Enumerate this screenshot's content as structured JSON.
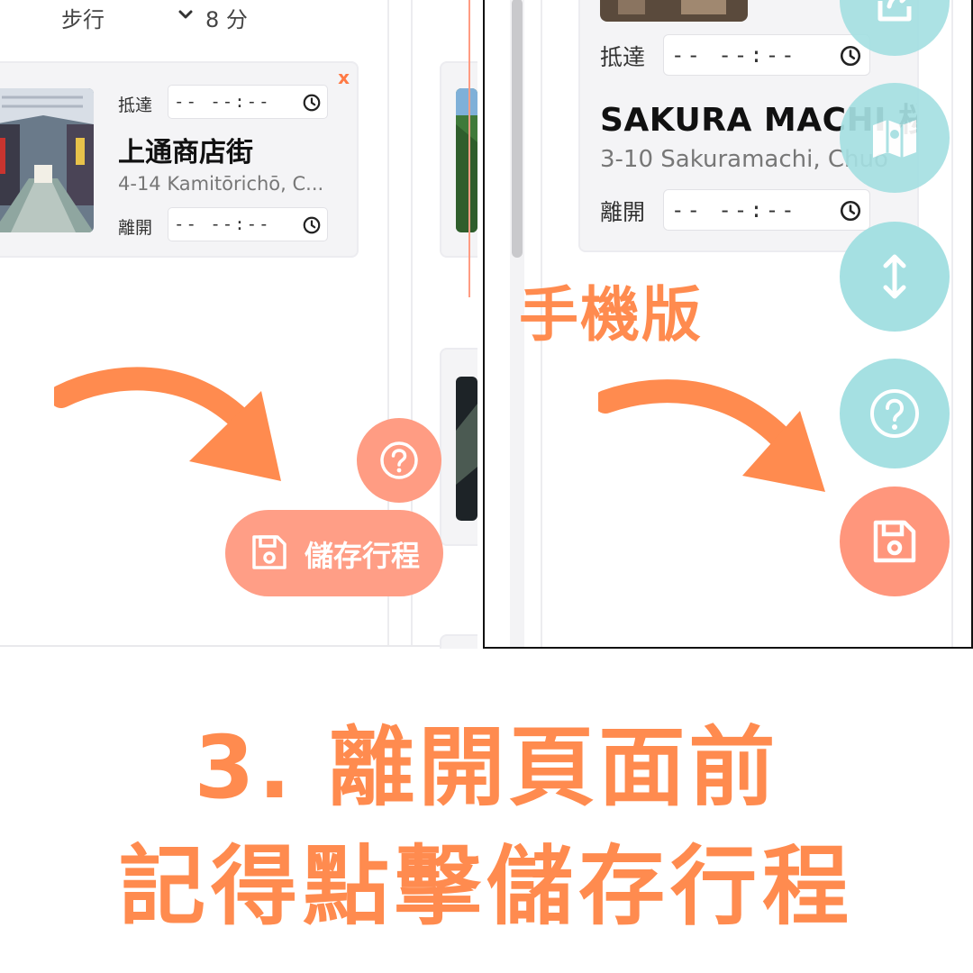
{
  "desktop": {
    "transport_mode": "步行",
    "duration": "8 分",
    "card": {
      "close_glyph": "x",
      "arrive_label": "抵達",
      "arrive_value": "-- --:--",
      "place_name": "上通商店街",
      "address": "4-14 Kamitōrichō, C...",
      "depart_label": "離開",
      "depart_value": "-- --:--"
    },
    "save_button_label": "儲存行程",
    "icons": [
      "chevron-down-icon",
      "clock-icon",
      "help-icon",
      "save-icon"
    ]
  },
  "mobile": {
    "title": "手機版",
    "card": {
      "arrive_label": "抵達",
      "arrive_value": "-- --:--",
      "place_name": "SAKURA MACHI 桜",
      "address": "3-10 Sakuramachi, Chuo",
      "depart_label": "離開",
      "depart_value": "-- --:--"
    },
    "icons": [
      "share-icon",
      "map-icon",
      "resize-vertical-icon",
      "help-icon",
      "save-icon"
    ]
  },
  "caption": {
    "line1": "3. 離開頁面前",
    "line2": "記得點擊儲存行程"
  },
  "colors": {
    "accent_orange": "#ff8b4f",
    "button_salmon": "#ff9e86",
    "fab_teal": "#a5e0e2",
    "close_x": "#ff7a45"
  }
}
